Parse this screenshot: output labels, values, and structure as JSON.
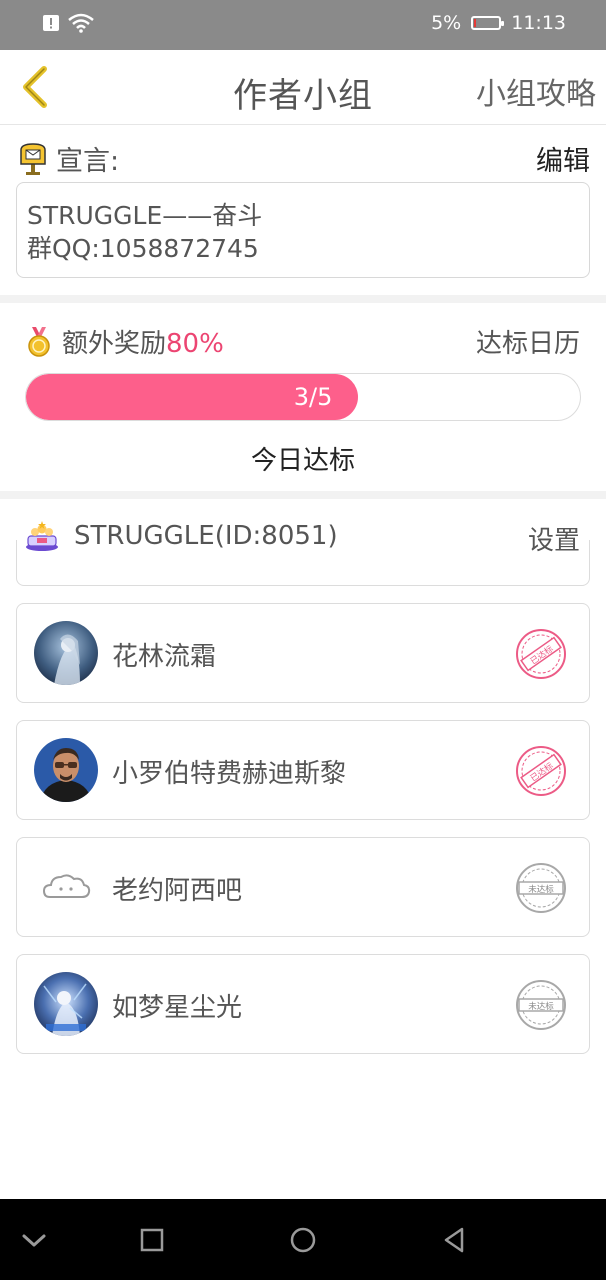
{
  "status_bar": {
    "battery_percent": "5%",
    "time": "11:13"
  },
  "header": {
    "title": "作者小组",
    "guide_link": "小组攻略"
  },
  "declaration": {
    "label": "宣言:",
    "edit_label": "编辑",
    "line1": "STRUGGLE——奋斗",
    "line2": "群QQ:1058872745"
  },
  "reward": {
    "label": "额外奖励",
    "percent": "80%",
    "calendar_link": "达标日历",
    "progress_text": "3/5",
    "progress_fraction": 0.6,
    "today_label": "今日达标"
  },
  "group": {
    "name": "STRUGGLE(ID:8051)",
    "settings_label": "设置",
    "members": [
      {
        "name": "花林流霜",
        "status": "达标",
        "status_text": "已达标"
      },
      {
        "name": "小罗伯特费赫迪斯黎",
        "status": "达标",
        "status_text": "已达标"
      },
      {
        "name": "老约阿西吧",
        "status": "未达标",
        "status_text": "未达标"
      },
      {
        "name": "如梦星尘光",
        "status": "未达标",
        "status_text": "未达标"
      }
    ]
  },
  "colors": {
    "accent": "#fd5f8b",
    "percent": "#ec4572",
    "stamp_done": "#ec5b86",
    "stamp_not": "#a8a8a8"
  }
}
